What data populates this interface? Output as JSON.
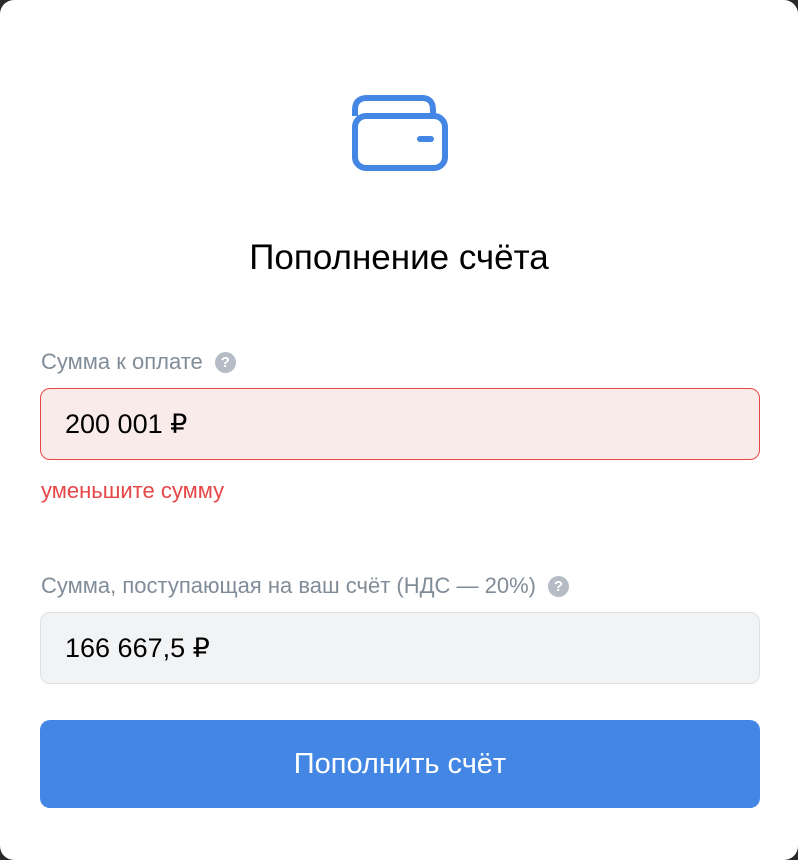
{
  "modal": {
    "icon": "wallet-icon",
    "title": "Пополнение счёта"
  },
  "amount_field": {
    "label": "Сумма к оплате",
    "help_icon": "help-icon",
    "value": "200 001 ₽",
    "error": "уменьшите сумму"
  },
  "received_field": {
    "label": "Сумма, поступающая на ваш счёт (НДС — 20%)",
    "help_icon": "help-icon",
    "value": "166 667,5 ₽"
  },
  "submit": {
    "label": "Пополнить счёт"
  },
  "colors": {
    "accent": "#4486e4",
    "error": "#e64646",
    "error_bg": "#f9ebea",
    "label": "#818c99"
  }
}
